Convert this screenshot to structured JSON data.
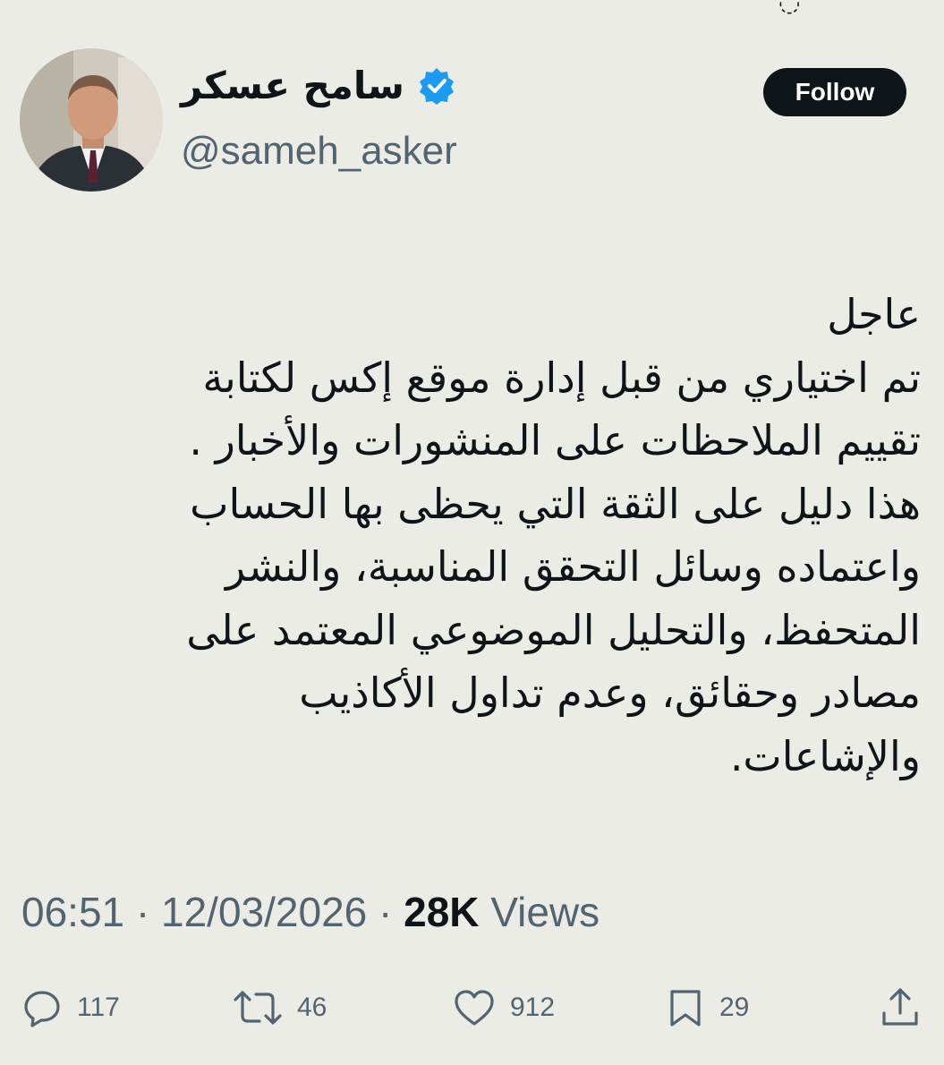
{
  "tweet": {
    "author": {
      "display_name": "سامح عسكر",
      "handle": "@sameh_asker",
      "verified": true
    },
    "follow_label": "Follow",
    "text_lines": [
      "عاجل",
      "تم اختياري من قبل إدارة موقع إكس لكتابة",
      "تقييم الملاحظات على المنشورات والأخبار .",
      "هذا دليل على الثقة التي يحظى بها الحساب",
      "واعتماده وسائل التحقق المناسبة، والنشر",
      "المتحفظ، والتحليل الموضوعي المعتمد على",
      "مصادر وحقائق، وعدم تداول الأكاذيب",
      "والإشاعات."
    ],
    "time": "06:51",
    "separator": "·",
    "date": "12/03/2026",
    "views_count": "28K",
    "views_label": "Views",
    "actions": {
      "reply_count": "117",
      "retweet_count": "46",
      "like_count": "912",
      "bookmark_count": "29"
    }
  },
  "colors": {
    "background": "#ecece7",
    "text_primary": "#0f1419",
    "text_secondary": "#536471",
    "verified_badge": "#1d9bf0",
    "follow_button_bg": "#0f1419"
  },
  "icons": [
    "verified-badge-icon",
    "reply-icon",
    "retweet-icon",
    "like-icon",
    "bookmark-icon",
    "share-icon"
  ]
}
